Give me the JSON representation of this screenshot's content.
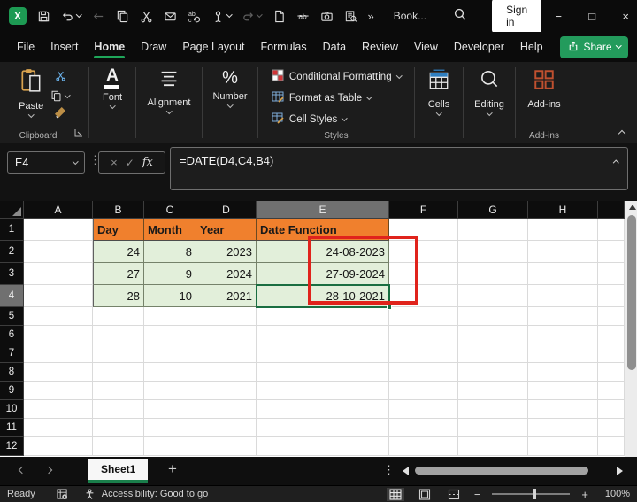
{
  "window": {
    "title": "Book...",
    "sign_in_label": "Sign in"
  },
  "qat_icons": [
    "excel-logo",
    "save",
    "undo",
    "go-back",
    "copy",
    "cut",
    "email",
    "find-replace",
    "touch-mode",
    "redo",
    "new-file",
    "strikethrough",
    "camera",
    "print-preview",
    "more-commands",
    "search"
  ],
  "ribbon": {
    "tabs": [
      "File",
      "Insert",
      "Home",
      "Draw",
      "Page Layout",
      "Formulas",
      "Data",
      "Review",
      "View",
      "Developer",
      "Help"
    ],
    "active_tab": "Home",
    "share_label": "Share",
    "clipboard": {
      "paste": "Paste",
      "label": "Clipboard"
    },
    "font": {
      "label": "Font"
    },
    "alignment": {
      "label": "Alignment"
    },
    "number": {
      "label": "Number"
    },
    "styles": {
      "items": [
        "Conditional Formatting",
        "Format as Table",
        "Cell Styles"
      ],
      "label": "Styles"
    },
    "cells": {
      "label": "Cells"
    },
    "editing": {
      "label": "Editing"
    },
    "addins": {
      "button": "Add-ins",
      "label": "Add-ins"
    }
  },
  "formula_bar": {
    "name_box": "E4",
    "formula": "=DATE(D4,C4,B4)"
  },
  "sheet": {
    "columns": [
      "A",
      "B",
      "C",
      "D",
      "E",
      "F",
      "G",
      "H"
    ],
    "row_numbers": [
      1,
      2,
      3,
      4,
      5,
      6,
      7,
      8,
      9,
      10,
      11,
      12
    ],
    "selected_cell": "E4",
    "selected_column": "E",
    "selected_row": 4,
    "header_row": {
      "row": 1,
      "cells": {
        "B": "Day",
        "C": "Month",
        "D": "Year",
        "E": "Date Function"
      }
    },
    "data_rows": [
      {
        "row": 2,
        "B": "24",
        "C": "8",
        "D": "2023",
        "E": "24-08-2023"
      },
      {
        "row": 3,
        "B": "27",
        "C": "9",
        "D": "2024",
        "E": "27-09-2024"
      },
      {
        "row": 4,
        "B": "28",
        "C": "10",
        "D": "2021",
        "E": "28-10-2021"
      }
    ]
  },
  "tab_bar": {
    "sheet_tab": "Sheet1",
    "add_sheet": "+"
  },
  "status_bar": {
    "mode": "Ready",
    "accessibility": "Accessibility: Good to go",
    "zoom_level": "100%"
  },
  "colors": {
    "excel_green": "#21A366",
    "header_orange": "#F0802D",
    "cell_green": "#E2EFDA",
    "annotation_red": "#E0231C",
    "selection_green": "#1A6E41"
  }
}
